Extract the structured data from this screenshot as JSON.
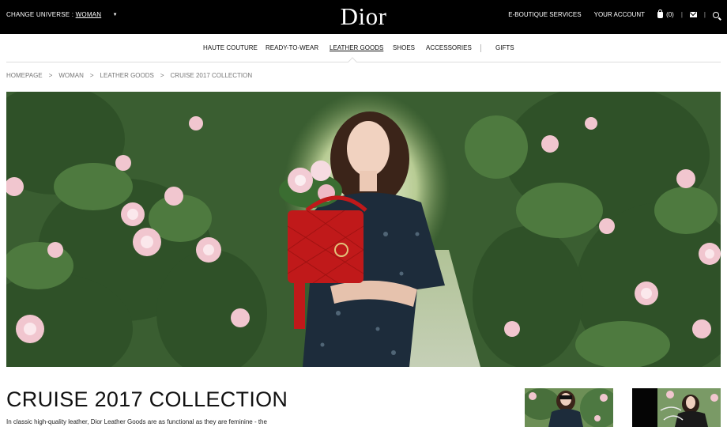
{
  "header": {
    "universe_label": "CHANGE UNIVERSE :",
    "universe_value": "WOMAN",
    "logo": "Dior",
    "eboutique": "E-BOUTIQUE SERVICES",
    "account": "YOUR ACCOUNT",
    "cart_count": "(0)",
    "separator": "|"
  },
  "nav": {
    "haute_couture": "HAUTE COUTURE",
    "ready_to_wear": "READY-TO-WEAR",
    "leather_goods": "LEATHER GOODS",
    "shoes": "SHOES",
    "accessories": "ACCESSORIES",
    "gifts": "GIFTS"
  },
  "breadcrumb": {
    "items": [
      "HOMEPAGE",
      "WOMAN",
      "LEATHER GOODS",
      "CRUISE 2017 COLLECTION"
    ],
    "separator": ">"
  },
  "content": {
    "title": "CRUISE 2017 COLLECTION",
    "description": "In classic high-quality leather, Dior Leather Goods are as functional as they are feminine - the"
  },
  "colors": {
    "topbar": "#000000",
    "bag_red": "#c0191a",
    "foliage": "#3c6b36",
    "rose": "#f1c6cf"
  },
  "icons": [
    "caret-down-icon",
    "bag-icon",
    "mail-icon",
    "search-icon"
  ]
}
